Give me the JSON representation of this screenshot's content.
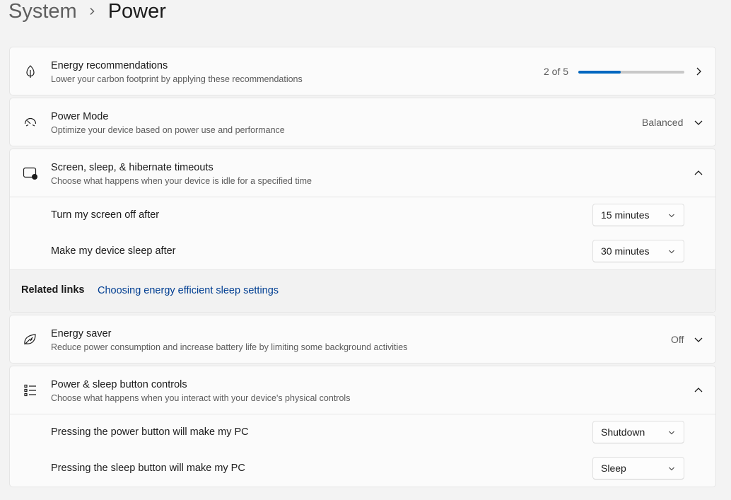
{
  "breadcrumb": {
    "parent": "System",
    "current": "Power"
  },
  "energy_recommendations": {
    "title": "Energy recommendations",
    "subtitle": "Lower your carbon footprint by applying these recommendations",
    "progress_text": "2 of 5",
    "progress_fraction": 0.4,
    "accent": "#0067c0"
  },
  "power_mode": {
    "title": "Power Mode",
    "subtitle": "Optimize your device based on power use and performance",
    "value": "Balanced"
  },
  "timeouts": {
    "title": "Screen, sleep, & hibernate timeouts",
    "subtitle": "Choose what happens when your device is idle for a specified time",
    "rows": [
      {
        "label": "Turn my screen off after",
        "value": "15 minutes"
      },
      {
        "label": "Make my device sleep after",
        "value": "30 minutes"
      }
    ],
    "related_label": "Related links",
    "related_link": "Choosing energy efficient sleep settings"
  },
  "energy_saver": {
    "title": "Energy saver",
    "subtitle": "Reduce power consumption and increase battery life by limiting some background activities",
    "value": "Off"
  },
  "button_controls": {
    "title": "Power & sleep button controls",
    "subtitle": "Choose what happens when you interact with your device's physical controls",
    "rows": [
      {
        "label": "Pressing the power button will make my PC",
        "value": "Shutdown"
      },
      {
        "label": "Pressing the sleep button will make my PC",
        "value": "Sleep"
      }
    ]
  },
  "icons": [
    "leaf-icon",
    "gauge-icon",
    "screen-timeout-icon",
    "energy-saver-icon",
    "button-list-icon",
    "chevron-right-icon",
    "chevron-down-icon",
    "chevron-up-icon"
  ]
}
